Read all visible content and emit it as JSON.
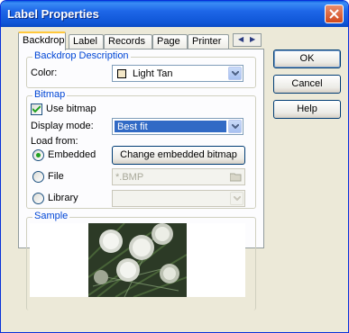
{
  "window": {
    "title": "Label Properties"
  },
  "tabs": [
    {
      "label": "Backdrop",
      "active": true
    },
    {
      "label": "Label"
    },
    {
      "label": "Records"
    },
    {
      "label": "Page"
    },
    {
      "label": "Printer"
    }
  ],
  "backdrop": {
    "title": "Backdrop Description",
    "color_label": "Color:",
    "color_value": "Light Tan",
    "color_swatch": "#f4e8c8"
  },
  "bitmap": {
    "title": "Bitmap",
    "use_bitmap_label": "Use bitmap",
    "use_bitmap_checked": true,
    "display_mode_label": "Display mode:",
    "display_mode_value": "Best fit",
    "load_from_label": "Load from:",
    "options": [
      {
        "label": "Embedded",
        "selected": true
      },
      {
        "label": "File",
        "selected": false
      },
      {
        "label": "Library",
        "selected": false
      }
    ],
    "change_button": "Change embedded bitmap",
    "file_value": "*.BMP",
    "library_value": ""
  },
  "sample": {
    "title": "Sample"
  },
  "buttons": {
    "ok": "OK",
    "cancel": "Cancel",
    "help": "Help"
  },
  "colors": {
    "title_bar": "#0a5ce0",
    "group_title": "#0046d5",
    "selection": "#316ac5",
    "face": "#ece9d8"
  }
}
